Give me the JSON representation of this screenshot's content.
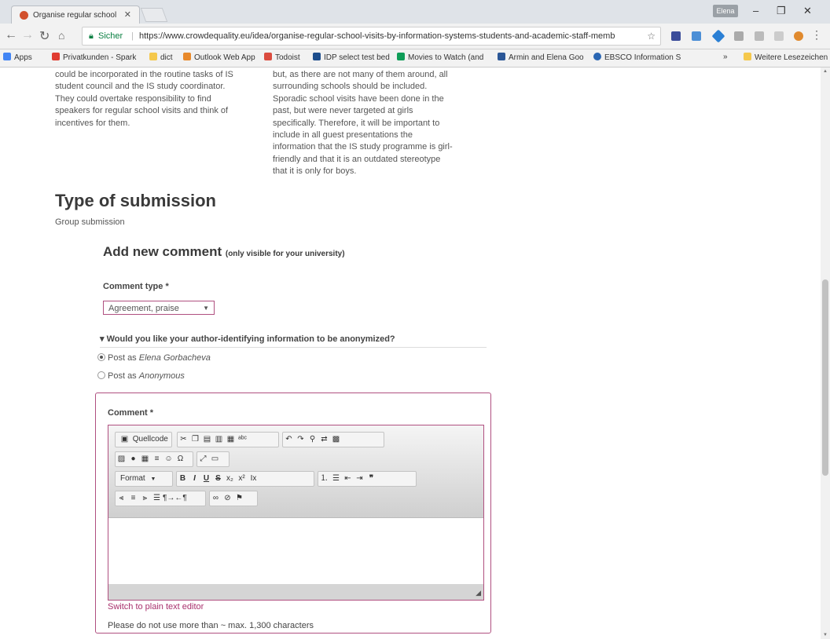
{
  "browser": {
    "tab_title": "Organise regular school",
    "tab_close": "✕",
    "profile": "Elena",
    "secure_label": "Sicher",
    "url": "https://www.crowdequality.eu/idea/organise-regular-school-visits-by-information-systems-students-and-academic-staff-memb",
    "bookmarks": [
      "Apps",
      "Privatkunden - Spark",
      "dict",
      "Outlook Web App",
      "Todoist",
      "IDP select test bed",
      "Movies to Watch (and",
      "Armin and Elena Goo",
      "EBSCO Information S",
      "»",
      "Weitere Lesezeichen"
    ]
  },
  "page": {
    "left_col": [
      "could be incorporated in the routine tasks of IS",
      "student council and the IS study coordinator.",
      "They could overtake responsibility to find",
      "speakers for regular school visits and think of",
      "incentives for them."
    ],
    "right_col": [
      "but, as there are not many of them around, all",
      "surrounding schools should be included.",
      "Sporadic school visits have been done in the",
      "past, but were never targeted at girls",
      "specifically. Therefore, it will be important to",
      "include in all guest presentations the",
      "information that the IS study programme is girl-",
      "friendly and that it is an outdated stereotype",
      "that it is only for boys."
    ],
    "type_heading": "Type of submission",
    "type_value": "Group submission",
    "add_comment": "Add new comment",
    "add_comment_note": "(only visible for your university)",
    "comment_type_label": "Comment type *",
    "comment_type_value": "Agreement, praise",
    "anon_question": "▾ Would you like your author-identifying information to be anonymized?",
    "post_as_prefix": "Post as",
    "post_as_name": "Elena Gorbacheva",
    "post_as_anon": "Anonymous",
    "comment_label": "Comment *",
    "source_btn": "Quellcode",
    "format_label": "Format",
    "switch_link": "Switch to plain text editor",
    "hint": "Please do not use more than ~ max. 1,300 characters"
  }
}
